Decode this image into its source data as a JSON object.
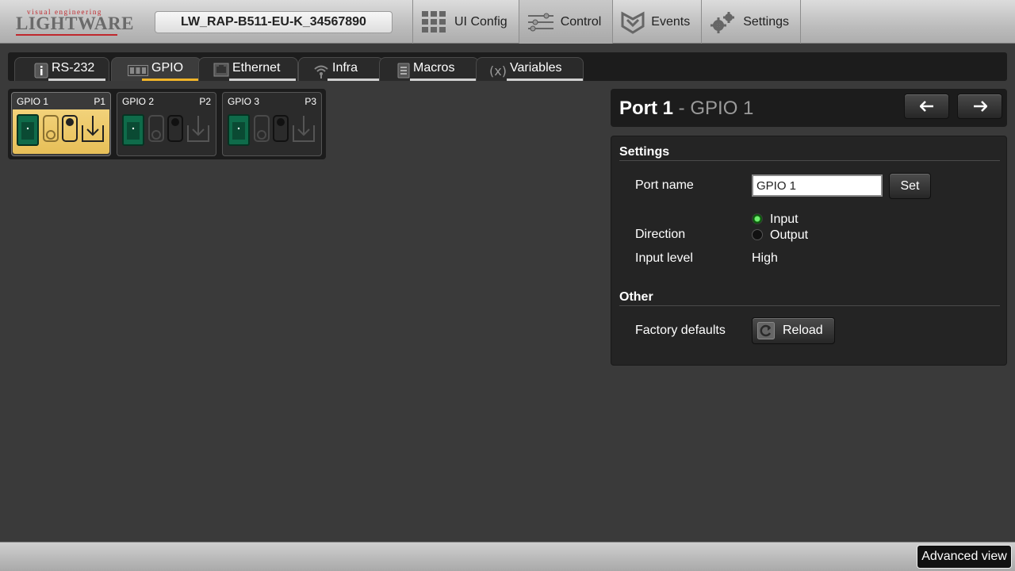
{
  "header": {
    "logo_tagline": "visual engineering",
    "logo_name": "LIGHTWARE",
    "device_label": "LW_RAP-B511-EU-K_34567890",
    "nav": [
      {
        "label": "UI Config",
        "icon": "grid-icon"
      },
      {
        "label": "Control",
        "icon": "sliders-icon",
        "active": true
      },
      {
        "label": "Events",
        "icon": "events-icon"
      },
      {
        "label": "Settings",
        "icon": "gears-icon"
      }
    ]
  },
  "subtabs": [
    {
      "label": "RS-232",
      "icon": "info-icon"
    },
    {
      "label": "GPIO",
      "icon": "gpio-icon",
      "active": true
    },
    {
      "label": "Ethernet",
      "icon": "ethernet-icon"
    },
    {
      "label": "Infra",
      "icon": "infrared-icon"
    },
    {
      "label": "Macros",
      "icon": "document-icon"
    },
    {
      "label": "Variables",
      "icon": "variable-icon"
    }
  ],
  "ports": [
    {
      "name": "GPIO 1",
      "port": "P1",
      "selected": true
    },
    {
      "name": "GPIO 2",
      "port": "P2",
      "selected": false
    },
    {
      "name": "GPIO 3",
      "port": "P3",
      "selected": false
    }
  ],
  "detail": {
    "title": "Port 1",
    "separator": " - ",
    "subtitle": "GPIO 1",
    "settings_title": "Settings",
    "port_name_label": "Port name",
    "port_name_value": "GPIO 1",
    "set_label": "Set",
    "direction_label": "Direction",
    "direction_options": [
      "Input",
      "Output"
    ],
    "direction_selected": "Input",
    "input_level_label": "Input level",
    "input_level_value": "High",
    "other_title": "Other",
    "factory_label": "Factory defaults",
    "reload_label": "Reload"
  },
  "footer": {
    "advanced_view_label": "Advanced view"
  },
  "colors": {
    "accent": "#f0b429",
    "selected_tile": "#e7bf58",
    "connector_green": "#0f6b4a",
    "radio_on": "#6cf06c",
    "logo_red": "#c0282d"
  }
}
